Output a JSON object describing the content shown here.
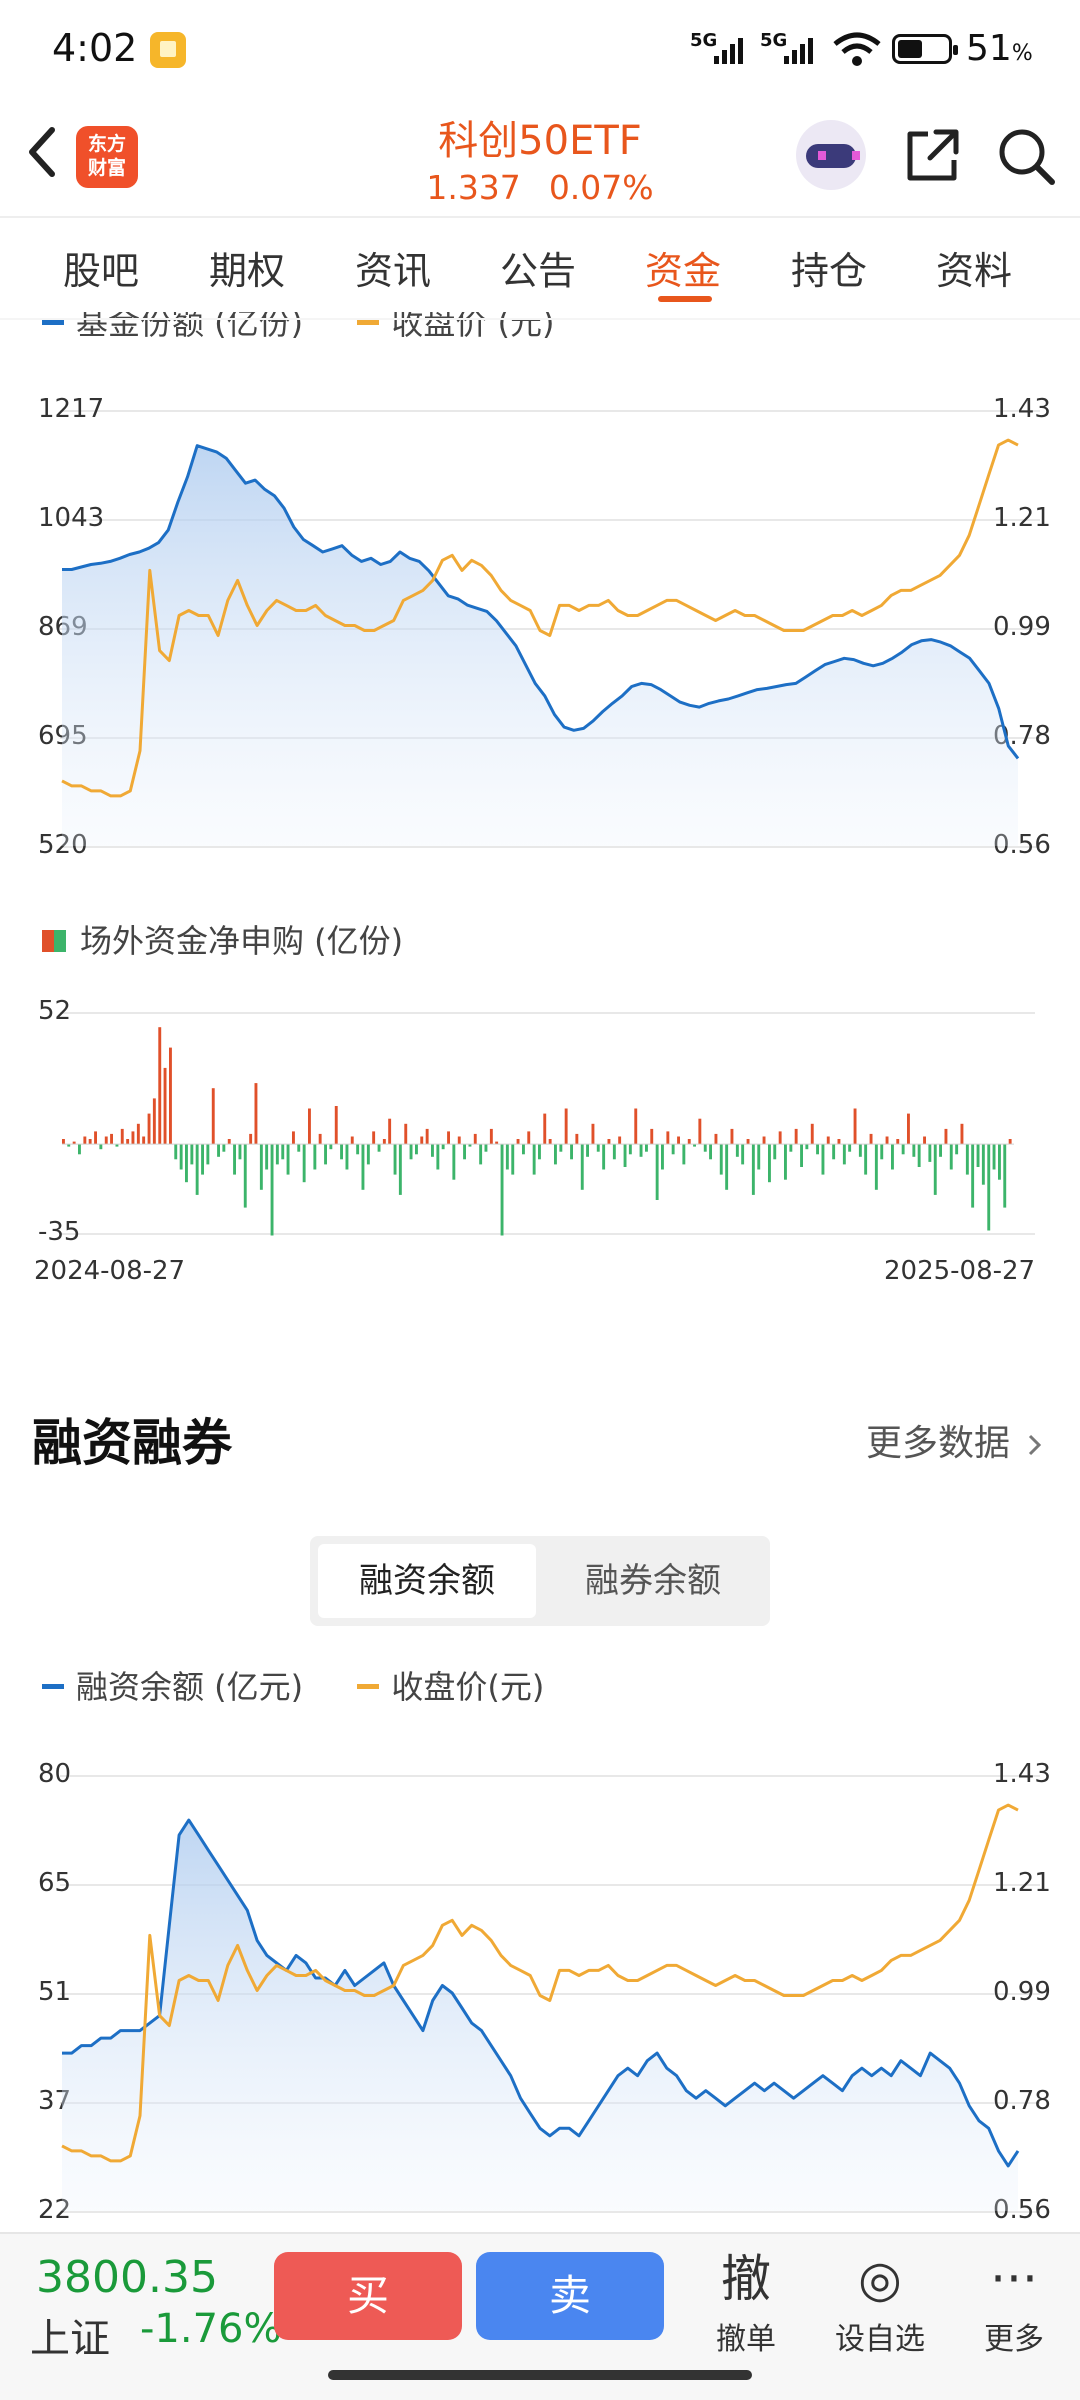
{
  "status_bar": {
    "time": "4:02",
    "signal1": "5G",
    "signal2": "5G",
    "battery": "51",
    "battery_unit": "%"
  },
  "header": {
    "logo_line1": "东方",
    "logo_line2": "财富",
    "stock_name": "科创50ETF",
    "price": "1.337",
    "change_pct": "0.07%"
  },
  "tabs": [
    {
      "label": "股吧"
    },
    {
      "label": "期权"
    },
    {
      "label": "资讯"
    },
    {
      "label": "公告"
    },
    {
      "label": "资金",
      "active": true
    },
    {
      "label": "持仓"
    },
    {
      "label": "资料"
    }
  ],
  "colors": {
    "accent": "#e8561c",
    "blue_series": "#1d6fc5",
    "orange_series": "#f0a935",
    "inflow": "#e0502a",
    "outflow": "#3cb46a",
    "down_green": "#1a9a3a"
  },
  "chart_data": [
    {
      "type": "line",
      "legend": [
        "基金份额 (亿份)",
        "收盘价 (元)"
      ],
      "left_ticks": [
        "1217",
        "1043",
        "869",
        "695",
        "520"
      ],
      "right_ticks": [
        "1.43",
        "1.21",
        "0.99",
        "0.78",
        "0.56"
      ],
      "ylim_left": [
        520,
        1217
      ],
      "ylim_right": [
        0.56,
        1.43
      ],
      "series": [
        {
          "name": "基金份额 (亿份)",
          "axis": "left",
          "values": [
            962,
            962,
            966,
            970,
            972,
            975,
            980,
            986,
            990,
            996,
            1005,
            1025,
            1070,
            1110,
            1160,
            1155,
            1150,
            1140,
            1120,
            1100,
            1105,
            1090,
            1080,
            1060,
            1030,
            1010,
            1000,
            990,
            995,
            1000,
            985,
            975,
            980,
            970,
            975,
            990,
            980,
            975,
            960,
            940,
            920,
            915,
            905,
            900,
            895,
            880,
            860,
            840,
            810,
            780,
            760,
            730,
            710,
            705,
            708,
            720,
            735,
            748,
            760,
            775,
            780,
            778,
            770,
            760,
            750,
            745,
            742,
            748,
            752,
            755,
            760,
            765,
            770,
            772,
            775,
            778,
            780,
            790,
            800,
            810,
            815,
            820,
            818,
            812,
            808,
            812,
            820,
            830,
            842,
            848,
            850,
            846,
            840,
            830,
            820,
            800,
            780,
            740,
            680,
            660
          ]
        },
        {
          "name": "收盘价 (元)",
          "axis": "right",
          "values": [
            0.69,
            0.68,
            0.68,
            0.67,
            0.67,
            0.66,
            0.66,
            0.67,
            0.75,
            1.11,
            0.95,
            0.93,
            1.02,
            1.03,
            1.02,
            1.02,
            0.98,
            1.05,
            1.09,
            1.04,
            1.0,
            1.03,
            1.05,
            1.04,
            1.03,
            1.03,
            1.04,
            1.02,
            1.01,
            1.0,
            1.0,
            0.99,
            0.99,
            1.0,
            1.01,
            1.05,
            1.06,
            1.07,
            1.09,
            1.13,
            1.14,
            1.11,
            1.13,
            1.12,
            1.1,
            1.07,
            1.05,
            1.04,
            1.03,
            0.99,
            0.98,
            1.04,
            1.04,
            1.03,
            1.04,
            1.04,
            1.05,
            1.03,
            1.02,
            1.02,
            1.03,
            1.04,
            1.05,
            1.05,
            1.04,
            1.03,
            1.02,
            1.01,
            1.02,
            1.03,
            1.02,
            1.02,
            1.01,
            1.0,
            0.99,
            0.99,
            0.99,
            1.0,
            1.01,
            1.02,
            1.02,
            1.03,
            1.02,
            1.03,
            1.04,
            1.06,
            1.07,
            1.07,
            1.08,
            1.09,
            1.1,
            1.12,
            1.14,
            1.18,
            1.24,
            1.3,
            1.36,
            1.37,
            1.36
          ]
        }
      ]
    },
    {
      "type": "bar",
      "legend": [
        "场外资金净申购 (亿份)"
      ],
      "ylim": [
        -35,
        52
      ],
      "y_ticks": [
        "52",
        "-35"
      ],
      "x_ticks": [
        "2024-08-27",
        "2025-08-27"
      ],
      "values": [
        2,
        -1,
        1,
        -4,
        3,
        2,
        5,
        -2,
        3,
        4,
        -1,
        6,
        2,
        5,
        8,
        3,
        12,
        18,
        46,
        30,
        38,
        -6,
        -10,
        -15,
        -8,
        -20,
        -12,
        -8,
        22,
        -5,
        -3,
        2,
        -12,
        -6,
        -25,
        4,
        24,
        -18,
        -10,
        -36,
        -8,
        -6,
        -12,
        5,
        -3,
        -15,
        14,
        -10,
        4,
        -8,
        -2,
        15,
        -6,
        -10,
        3,
        -4,
        -18,
        -8,
        5,
        -3,
        2,
        10,
        -12,
        -20,
        8,
        -6,
        -4,
        3,
        6,
        -5,
        -10,
        -2,
        5,
        -14,
        3,
        -6,
        -1,
        4,
        -8,
        -3,
        6,
        1,
        -36,
        -10,
        -12,
        2,
        -4,
        5,
        -12,
        -6,
        12,
        2,
        -8,
        -3,
        14,
        -6,
        4,
        -18,
        -5,
        8,
        -3,
        -10,
        2,
        -6,
        3,
        -9,
        -4,
        14,
        -5,
        -3,
        6,
        -22,
        -10,
        5,
        -4,
        3,
        -8,
        2,
        -1,
        10,
        -3,
        -6,
        4,
        -12,
        -18,
        6,
        -5,
        -8,
        2,
        -20,
        -10,
        3,
        -15,
        -6,
        5,
        -14,
        -3,
        6,
        -9,
        -2,
        8,
        -4,
        -12,
        3,
        -6,
        2,
        -8,
        -3,
        14,
        -5,
        -12,
        4,
        -18,
        -6,
        3,
        -10,
        2,
        -4,
        12,
        -5,
        -9,
        3,
        -7,
        -20,
        -5,
        6,
        -10,
        -4,
        8,
        -12,
        -25,
        -9,
        -16,
        -34,
        -10,
        -14,
        -25,
        2
      ]
    },
    {
      "type": "line",
      "legend": [
        "融资余额 (亿元)",
        "收盘价(元)"
      ],
      "left_ticks": [
        "80",
        "65",
        "51",
        "37",
        "22"
      ],
      "right_ticks": [
        "1.43",
        "1.21",
        "0.99",
        "0.78",
        "0.56"
      ],
      "ylim_left": [
        22,
        80
      ],
      "ylim_right": [
        0.56,
        1.43
      ],
      "series": [
        {
          "name": "融资余额 (亿元)",
          "axis": "left",
          "values": [
            43,
            43,
            44,
            44,
            45,
            45,
            46,
            46,
            46,
            47,
            48,
            60,
            72,
            74,
            72,
            70,
            68,
            66,
            64,
            62,
            58,
            56,
            55,
            54,
            56,
            55,
            53,
            53,
            52,
            54,
            52,
            53,
            54,
            55,
            52,
            50,
            48,
            46,
            50,
            52,
            51,
            49,
            47,
            46,
            44,
            42,
            40,
            37,
            35,
            33,
            32,
            33,
            33,
            32,
            34,
            36,
            38,
            40,
            41,
            40,
            42,
            43,
            41,
            40,
            38,
            37,
            38,
            37,
            36,
            37,
            38,
            39,
            38,
            39,
            38,
            37,
            38,
            39,
            40,
            39,
            38,
            40,
            41,
            40,
            41,
            40,
            42,
            41,
            40,
            43,
            42,
            41,
            39,
            36,
            34,
            33,
            30,
            28,
            30
          ]
        },
        {
          "name": "收盘价(元)",
          "axis": "right",
          "values": [
            0.69,
            0.68,
            0.68,
            0.67,
            0.67,
            0.66,
            0.66,
            0.67,
            0.75,
            1.11,
            0.95,
            0.93,
            1.02,
            1.03,
            1.02,
            1.02,
            0.98,
            1.05,
            1.09,
            1.04,
            1.0,
            1.03,
            1.05,
            1.04,
            1.03,
            1.03,
            1.04,
            1.02,
            1.01,
            1.0,
            1.0,
            0.99,
            0.99,
            1.0,
            1.01,
            1.05,
            1.06,
            1.07,
            1.09,
            1.13,
            1.14,
            1.11,
            1.13,
            1.12,
            1.1,
            1.07,
            1.05,
            1.04,
            1.03,
            0.99,
            0.98,
            1.04,
            1.04,
            1.03,
            1.04,
            1.04,
            1.05,
            1.03,
            1.02,
            1.02,
            1.03,
            1.04,
            1.05,
            1.05,
            1.04,
            1.03,
            1.02,
            1.01,
            1.02,
            1.03,
            1.02,
            1.02,
            1.01,
            1.0,
            0.99,
            0.99,
            0.99,
            1.0,
            1.01,
            1.02,
            1.02,
            1.03,
            1.02,
            1.03,
            1.04,
            1.06,
            1.07,
            1.07,
            1.08,
            1.09,
            1.1,
            1.12,
            1.14,
            1.18,
            1.24,
            1.3,
            1.36,
            1.37,
            1.36
          ]
        }
      ]
    }
  ],
  "margin_section": {
    "title": "融资融券",
    "more_link": "更多数据",
    "segments": [
      "融资余额",
      "融券余额"
    ]
  },
  "bottom_bar": {
    "index_value": "3800.35",
    "index_name": "上证",
    "index_change": "-1.76%",
    "buy": "买",
    "sell": "卖",
    "tools": [
      {
        "icon": "撤",
        "label": "撤单"
      },
      {
        "icon": "◎",
        "label": "设自选"
      },
      {
        "icon": "···",
        "label": "更多"
      }
    ]
  }
}
